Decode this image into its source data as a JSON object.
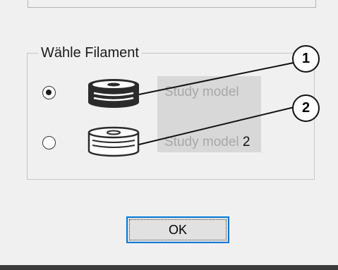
{
  "dialog": {
    "group_title": "Wähle Filament",
    "options": [
      {
        "label": "Study model",
        "suffix": "",
        "selected": true,
        "icon": "filament-spool-filled-icon"
      },
      {
        "label": "Study model",
        "suffix": "2",
        "selected": false,
        "icon": "filament-spool-outline-icon"
      }
    ],
    "ok_label": "OK"
  },
  "callouts": [
    "1",
    "2"
  ],
  "colors": {
    "accent": "#0078d7",
    "background": "#f0f0f0",
    "spool": "#2b2b2b"
  }
}
